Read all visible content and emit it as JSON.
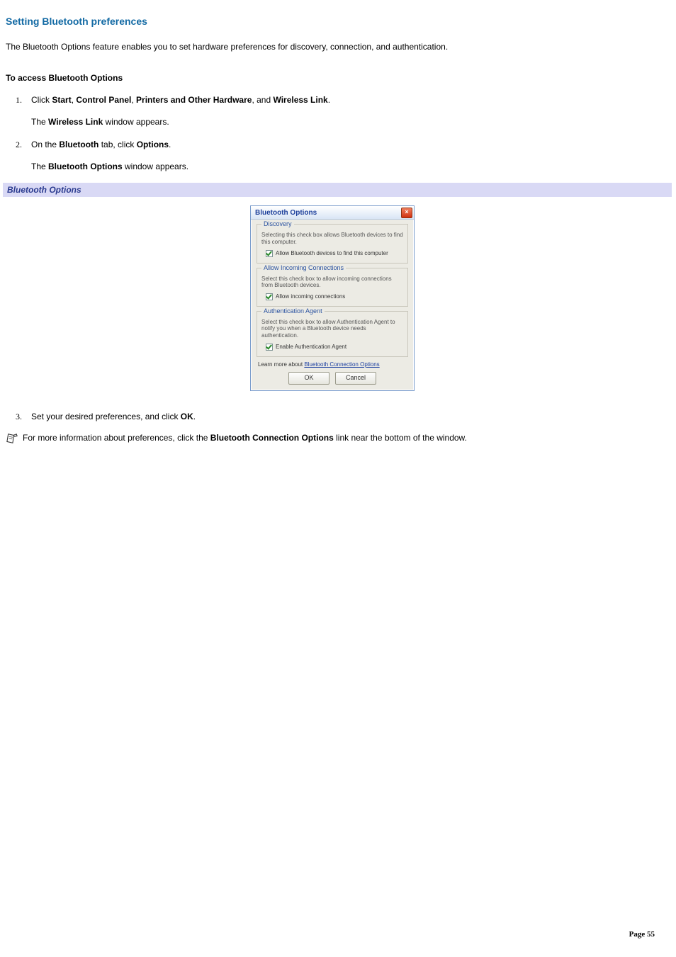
{
  "heading": "Setting Bluetooth preferences",
  "intro": "The Bluetooth Options feature enables you to set hardware preferences for discovery, connection, and authentication.",
  "subheading": "To access Bluetooth Options",
  "steps": {
    "s1": {
      "pre": "Click ",
      "b1": "Start",
      "c1": ", ",
      "b2": "Control Panel",
      "c2": ", ",
      "b3": "Printers and Other Hardware",
      "c3": ", and ",
      "b4": "Wireless Link",
      "c4": ".",
      "follow_pre": "The ",
      "follow_b": "Wireless Link",
      "follow_post": " window appears."
    },
    "s2": {
      "pre": "On the ",
      "b1": "Bluetooth",
      "mid": " tab, click ",
      "b2": "Options",
      "post": ".",
      "follow_pre": "The ",
      "follow_b": "Bluetooth Options",
      "follow_post": " window appears."
    },
    "s3": {
      "pre": "Set your desired preferences, and click ",
      "b1": "OK",
      "post": "."
    }
  },
  "caption": "Bluetooth Options",
  "dialog": {
    "title": "Bluetooth Options",
    "close_glyph": "×",
    "discovery": {
      "legend": "Discovery",
      "desc": "Selecting this check box allows Bluetooth devices to find this computer.",
      "checkbox_label": "Allow Bluetooth devices to find this computer"
    },
    "incoming": {
      "legend": "Allow Incoming Connections",
      "desc": "Select this check box to allow incoming connections from Bluetooth devices.",
      "checkbox_label": "Allow incoming connections"
    },
    "auth": {
      "legend": "Authentication Agent",
      "desc": "Select this check box to allow Authentication Agent to notify you when a Bluetooth device needs authentication.",
      "checkbox_label": "Enable Authentication Agent"
    },
    "learn_more_pre": "Learn more about ",
    "learn_more_link": "Bluetooth Connection Options",
    "ok": "OK",
    "cancel": "Cancel"
  },
  "note": {
    "pre": "For more information about preferences, click the ",
    "b1": "Bluetooth Connection Options",
    "post": " link near the bottom of the window."
  },
  "page_label": "Page ",
  "page_number": "55"
}
